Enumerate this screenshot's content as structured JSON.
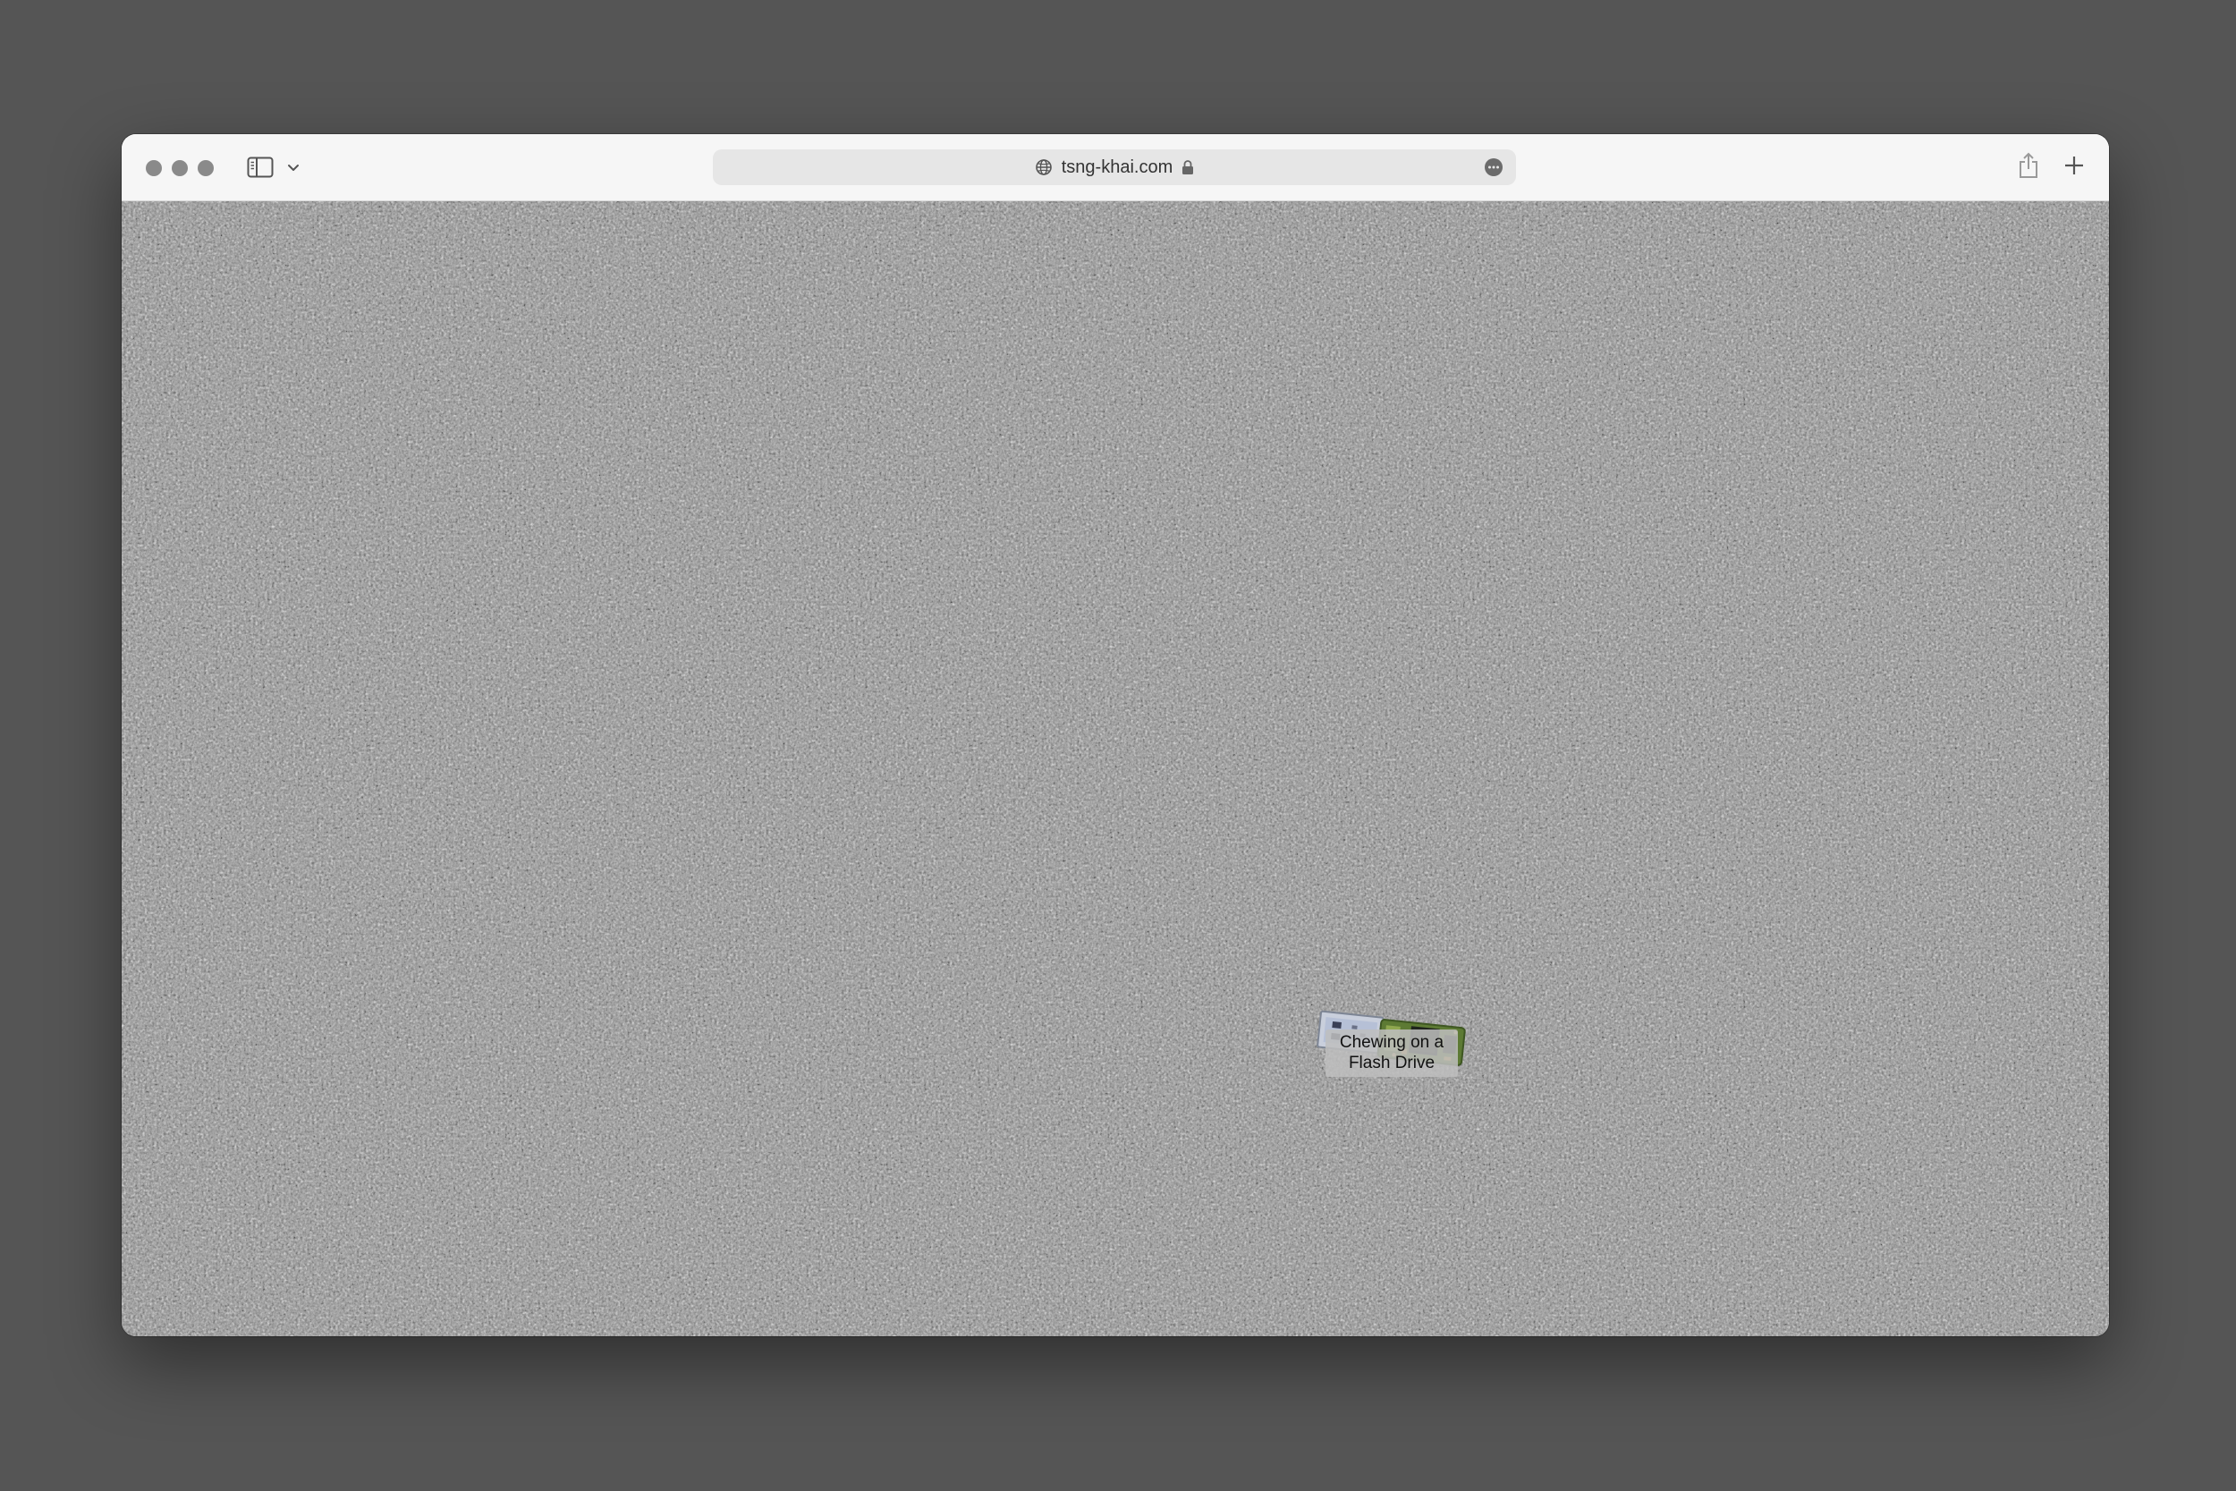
{
  "browser": {
    "url": "tsng-khai.com",
    "icons": {
      "close": "traffic-light-close",
      "minimize": "traffic-light-minimize",
      "maximize": "traffic-light-maximize",
      "sidebar": "sidebar-icon",
      "sidebar_menu": "chevron-down-icon",
      "site": "globe-icon",
      "secure": "lock-icon",
      "page_menu": "more-icon",
      "share": "share-icon",
      "new_tab": "plus-icon"
    },
    "colors": {
      "desktop_background": "#555555",
      "toolbar": "#f6f6f6",
      "address_bar": "#e6e6e6",
      "page_texture": "#8f8f8f"
    }
  },
  "page": {
    "background": "gravel-texture",
    "items": [
      {
        "label": "Chewing on a Flash Drive",
        "image": "usb-flash-drive-image"
      }
    ]
  }
}
